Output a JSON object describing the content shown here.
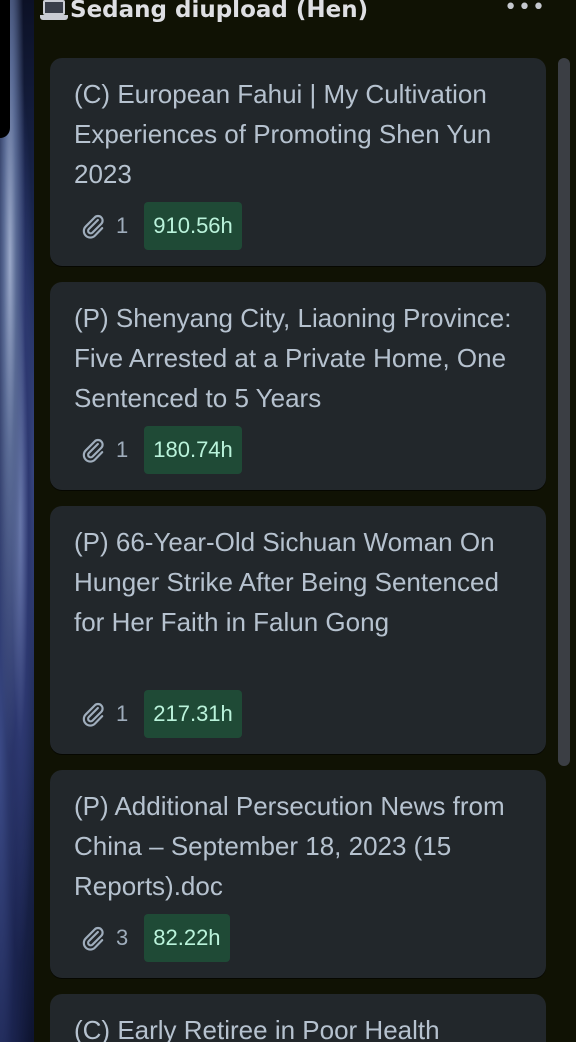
{
  "list": {
    "title": "Sedang diupload (Hen)",
    "title_icon": "laptop-icon",
    "more_icon": "more-icon"
  },
  "cards": [
    {
      "title": "(C) European Fahui | My Cultivation Experiences of Promoting Shen Yun 2023",
      "attachments": "1",
      "hours": "910.56h"
    },
    {
      "title": "(P) Shenyang City, Liaoning Province: Five Arrested at a Private Home, One Sentenced to 5 Years",
      "attachments": "1",
      "hours": "180.74h"
    },
    {
      "title": "(P) 66-Year-Old Sichuan Woman On Hunger Strike After Being Sentenced for Her Faith in Falun Gong",
      "attachments": "1",
      "hours": "217.31h"
    },
    {
      "title": "(P) Additional Persecution News from China – September 18, 2023 (15 Reports).doc",
      "attachments": "3",
      "hours": "82.22h"
    },
    {
      "title": "(C) Early Retiree in Poor Health"
    }
  ],
  "colors": {
    "card_bg": "#22272b",
    "card_text": "#b6c2cf",
    "badge_bg": "#1f4a36",
    "badge_text": "#baf3db",
    "list_bg": "#101204"
  }
}
